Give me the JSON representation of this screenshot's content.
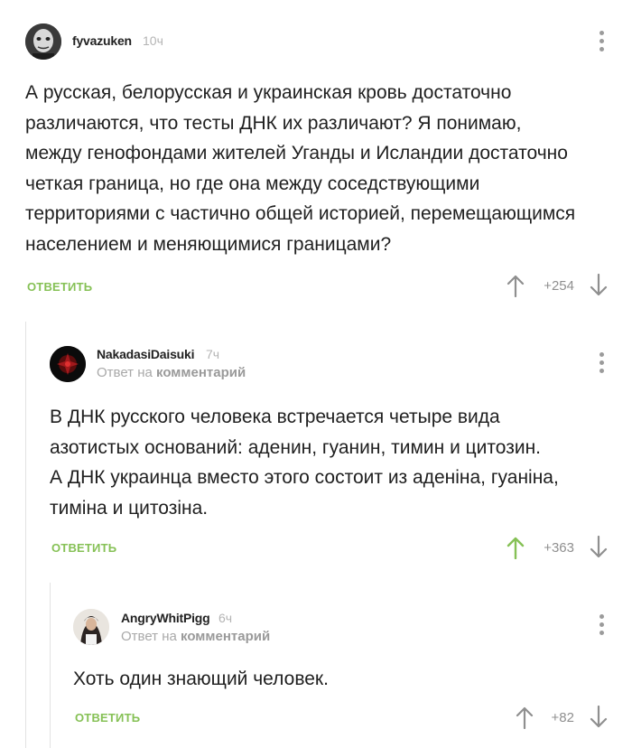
{
  "comments": [
    {
      "username": "fyvazuken",
      "time": "10ч",
      "text": "А русская, белорусская и украинская кровь достаточно\nразличаются, что тесты ДНК их различают? Я понимаю,\nмежду генофондами жителей Уганды и Исландии достаточно\nчеткая граница, но где она между соседствующими\nтерриториями с частично общей историей, перемещающимся\nнаселением и меняющимися границами?",
      "reply_label": "ОТВЕТИТЬ",
      "rating": "+254",
      "upvoted": false
    },
    {
      "username": "NakadasiDaisuki",
      "time": "7ч",
      "reply_prefix": "Ответ на",
      "reply_target": "комментарий",
      "text": "В ДНК русского человека встречается четыре вида\nазотистых оснований: аденин, гуанин, тимин и цитозин.\nА ДНК украинца вместо этого состоит из аденіна, гуаніна,\nтиміна и цитозіна.",
      "reply_label": "ОТВЕТИТЬ",
      "rating": "+363",
      "upvoted": true
    },
    {
      "username": "AngryWhitPigg",
      "time": "6ч",
      "reply_prefix": "Ответ на",
      "reply_target": "комментарий",
      "text": "Хоть один знающий человек.",
      "reply_label": "ОТВЕТИТЬ",
      "rating": "+82",
      "upvoted": false
    }
  ],
  "colors": {
    "accent_green": "#86c156",
    "arrow_gray": "#8f8f8f",
    "thread_line": "#e2e2e2"
  }
}
